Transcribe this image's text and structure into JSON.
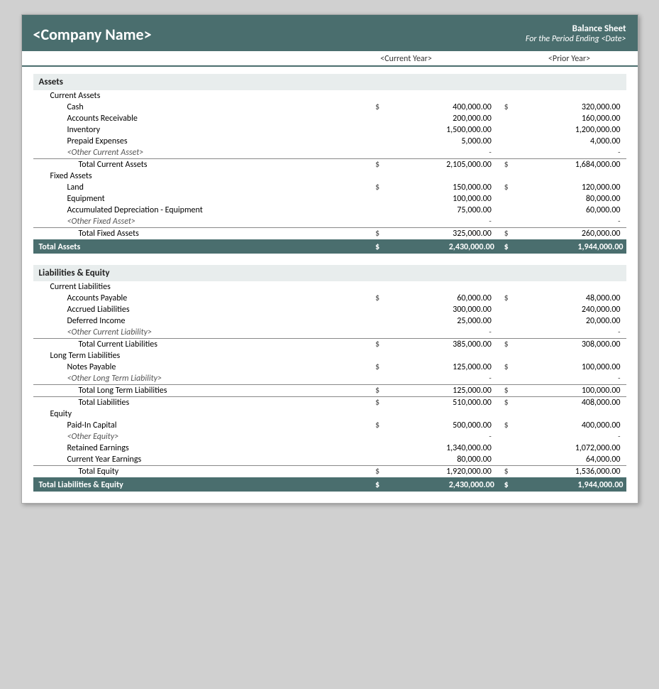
{
  "header": {
    "company_name": "<Company Name>",
    "report_title": "Balance Sheet",
    "report_subtitle": "For the Period Ending <Date>",
    "col_cy_label": "<Current Year>",
    "col_py_label": "<Prior Year>"
  },
  "assets": {
    "section_label": "Assets",
    "current_assets": {
      "label": "Current Assets",
      "items": [
        {
          "name": "Cash",
          "cy_dollar": "$",
          "cy_val": "400,000.00",
          "py_dollar": "$",
          "py_val": "320,000.00"
        },
        {
          "name": "Accounts Receivable",
          "cy_dollar": "",
          "cy_val": "200,000.00",
          "py_dollar": "",
          "py_val": "160,000.00"
        },
        {
          "name": "Inventory",
          "cy_dollar": "",
          "cy_val": "1,500,000.00",
          "py_dollar": "",
          "py_val": "1,200,000.00"
        },
        {
          "name": "Prepaid Expenses",
          "cy_dollar": "",
          "cy_val": "5,000.00",
          "py_dollar": "",
          "py_val": "4,000.00"
        },
        {
          "name": "<Other Current Asset>",
          "cy_dollar": "",
          "cy_val": "-",
          "py_dollar": "",
          "py_val": "-"
        }
      ],
      "total_label": "Total Current Assets",
      "total_cy_dollar": "$",
      "total_cy_val": "2,105,000.00",
      "total_py_dollar": "$",
      "total_py_val": "1,684,000.00"
    },
    "fixed_assets": {
      "label": "Fixed Assets",
      "items": [
        {
          "name": "Land",
          "cy_dollar": "$",
          "cy_val": "150,000.00",
          "py_dollar": "$",
          "py_val": "120,000.00"
        },
        {
          "name": "Equipment",
          "cy_dollar": "",
          "cy_val": "100,000.00",
          "py_dollar": "",
          "py_val": "80,000.00"
        },
        {
          "name": "Accumulated Depreciation - Equipment",
          "cy_dollar": "",
          "cy_val": "75,000.00",
          "py_dollar": "",
          "py_val": "60,000.00"
        },
        {
          "name": "<Other Fixed Asset>",
          "cy_dollar": "",
          "cy_val": "-",
          "py_dollar": "",
          "py_val": "-"
        }
      ],
      "total_label": "Total Fixed Assets",
      "total_cy_dollar": "$",
      "total_cy_val": "325,000.00",
      "total_py_dollar": "$",
      "total_py_val": "260,000.00"
    },
    "total_label": "Total Assets",
    "total_cy_dollar": "$",
    "total_cy_val": "2,430,000.00",
    "total_py_dollar": "$",
    "total_py_val": "1,944,000.00"
  },
  "liabilities_equity": {
    "section_label": "Liabilities & Equity",
    "current_liabilities": {
      "label": "Current Liabilities",
      "items": [
        {
          "name": "Accounts Payable",
          "cy_dollar": "$",
          "cy_val": "60,000.00",
          "py_dollar": "$",
          "py_val": "48,000.00"
        },
        {
          "name": "Accrued Liabilities",
          "cy_dollar": "",
          "cy_val": "300,000.00",
          "py_dollar": "",
          "py_val": "240,000.00"
        },
        {
          "name": "Deferred Income",
          "cy_dollar": "",
          "cy_val": "25,000.00",
          "py_dollar": "",
          "py_val": "20,000.00"
        },
        {
          "name": "<Other Current Liability>",
          "cy_dollar": "",
          "cy_val": "-",
          "py_dollar": "",
          "py_val": "-"
        }
      ],
      "total_label": "Total Current Liabilities",
      "total_cy_dollar": "$",
      "total_cy_val": "385,000.00",
      "total_py_dollar": "$",
      "total_py_val": "308,000.00"
    },
    "long_term_liabilities": {
      "label": "Long Term Liabilities",
      "items": [
        {
          "name": "Notes Payable",
          "cy_dollar": "$",
          "cy_val": "125,000.00",
          "py_dollar": "$",
          "py_val": "100,000.00"
        },
        {
          "name": "<Other Long Term Liability>",
          "cy_dollar": "",
          "cy_val": "-",
          "py_dollar": "",
          "py_val": "-"
        }
      ],
      "total_long_term_label": "Total Long Term Liabilities",
      "total_long_term_cy_dollar": "$",
      "total_long_term_cy_val": "125,000.00",
      "total_long_term_py_dollar": "$",
      "total_long_term_py_val": "100,000.00",
      "total_liabilities_label": "Total Liabilities",
      "total_liabilities_cy_dollar": "$",
      "total_liabilities_cy_val": "510,000.00",
      "total_liabilities_py_dollar": "$",
      "total_liabilities_py_val": "408,000.00"
    },
    "equity": {
      "label": "Equity",
      "items": [
        {
          "name": "Paid-In Capital",
          "cy_dollar": "$",
          "cy_val": "500,000.00",
          "py_dollar": "$",
          "py_val": "400,000.00"
        },
        {
          "name": "<Other Equity>",
          "cy_dollar": "",
          "cy_val": "-",
          "py_dollar": "",
          "py_val": "-"
        },
        {
          "name": "Retained Earnings",
          "cy_dollar": "",
          "cy_val": "1,340,000.00",
          "py_dollar": "",
          "py_val": "1,072,000.00"
        },
        {
          "name": "Current Year Earnings",
          "cy_dollar": "",
          "cy_val": "80,000.00",
          "py_dollar": "",
          "py_val": "64,000.00"
        }
      ],
      "total_equity_label": "Total Equity",
      "total_equity_cy_dollar": "$",
      "total_equity_cy_val": "1,920,000.00",
      "total_equity_py_dollar": "$",
      "total_equity_py_val": "1,536,000.00"
    },
    "total_label": "Total Liabilities & Equity",
    "total_cy_dollar": "$",
    "total_cy_val": "2,430,000.00",
    "total_py_dollar": "$",
    "total_py_val": "1,944,000.00"
  }
}
